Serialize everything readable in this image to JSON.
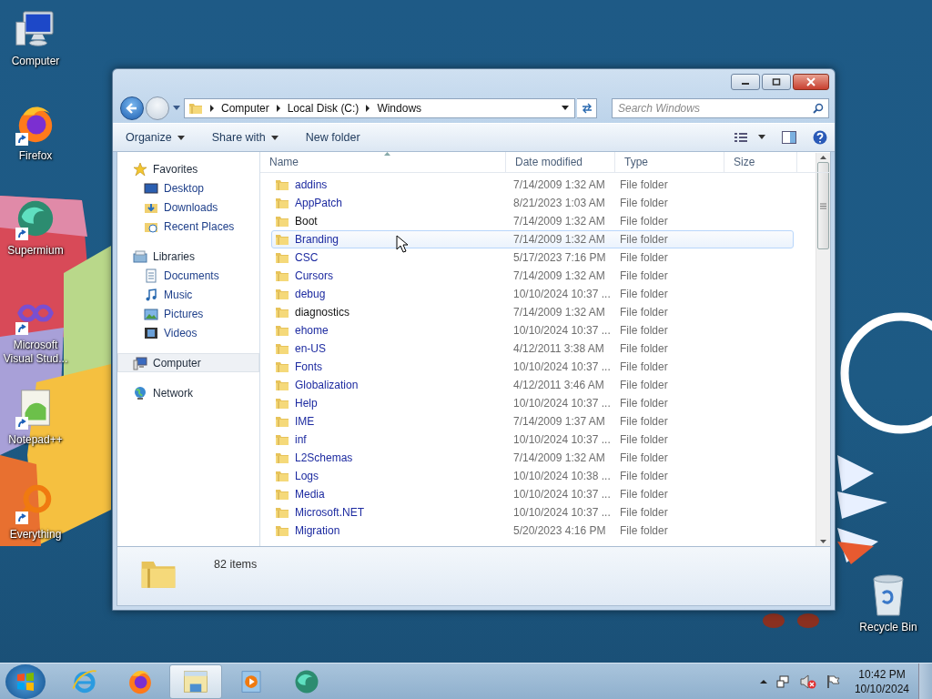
{
  "desktop_icons": [
    {
      "label": "Computer",
      "kind": "computer",
      "shortcut": false
    },
    {
      "label": "Firefox",
      "kind": "firefox",
      "shortcut": true
    },
    {
      "label": "Supermium",
      "kind": "supermium",
      "shortcut": true
    },
    {
      "label": "Microsoft Visual Stud...",
      "kind": "visualstudio",
      "shortcut": true
    },
    {
      "label": "Notepad++",
      "kind": "notepad",
      "shortcut": true
    },
    {
      "label": "Everything",
      "kind": "everything",
      "shortcut": true
    }
  ],
  "recycle_bin": {
    "label": "Recycle Bin"
  },
  "window": {
    "address": {
      "crumbs": [
        "Computer",
        "Local Disk (C:)",
        "Windows"
      ]
    },
    "search": {
      "placeholder": "Search Windows"
    },
    "toolbar": [
      {
        "label": "Organize",
        "dropdown": true
      },
      {
        "label": "Share with",
        "dropdown": true
      },
      {
        "label": "New folder",
        "dropdown": false
      }
    ],
    "nav": [
      {
        "label": "Favorites",
        "kind": "star",
        "selected": false,
        "children": [
          {
            "label": "Desktop",
            "kind": "desktop",
            "selected": false
          },
          {
            "label": "Downloads",
            "kind": "downloads",
            "selected": false
          },
          {
            "label": "Recent Places",
            "kind": "recent",
            "selected": false
          }
        ]
      },
      {
        "label": "Libraries",
        "kind": "libraries",
        "selected": false,
        "children": [
          {
            "label": "Documents",
            "kind": "documents",
            "selected": false
          },
          {
            "label": "Music",
            "kind": "music",
            "selected": false
          },
          {
            "label": "Pictures",
            "kind": "pictures",
            "selected": false
          },
          {
            "label": "Videos",
            "kind": "videos",
            "selected": false
          }
        ]
      },
      {
        "label": "Computer",
        "kind": "computer",
        "selected": true
      },
      {
        "label": "Network",
        "kind": "network",
        "selected": false
      }
    ],
    "columns": [
      "Name",
      "Date modified",
      "Type",
      "Size"
    ],
    "rows": [
      {
        "name": "addins",
        "date": "7/14/2009 1:32 AM",
        "type": "File folder",
        "compressed": true,
        "hovered": false
      },
      {
        "name": "AppPatch",
        "date": "8/21/2023 1:03 AM",
        "type": "File folder",
        "compressed": true,
        "hovered": false
      },
      {
        "name": "Boot",
        "date": "7/14/2009 1:32 AM",
        "type": "File folder",
        "compressed": false,
        "hovered": false
      },
      {
        "name": "Branding",
        "date": "7/14/2009 1:32 AM",
        "type": "File folder",
        "compressed": true,
        "hovered": true
      },
      {
        "name": "CSC",
        "date": "5/17/2023 7:16 PM",
        "type": "File folder",
        "compressed": true,
        "hovered": false
      },
      {
        "name": "Cursors",
        "date": "7/14/2009 1:32 AM",
        "type": "File folder",
        "compressed": true,
        "hovered": false
      },
      {
        "name": "debug",
        "date": "10/10/2024 10:37 ...",
        "type": "File folder",
        "compressed": true,
        "hovered": false
      },
      {
        "name": "diagnostics",
        "date": "7/14/2009 1:32 AM",
        "type": "File folder",
        "compressed": false,
        "hovered": false
      },
      {
        "name": "ehome",
        "date": "10/10/2024 10:37 ...",
        "type": "File folder",
        "compressed": true,
        "hovered": false
      },
      {
        "name": "en-US",
        "date": "4/12/2011 3:38 AM",
        "type": "File folder",
        "compressed": true,
        "hovered": false
      },
      {
        "name": "Fonts",
        "date": "10/10/2024 10:37 ...",
        "type": "File folder",
        "compressed": true,
        "hovered": false
      },
      {
        "name": "Globalization",
        "date": "4/12/2011 3:46 AM",
        "type": "File folder",
        "compressed": true,
        "hovered": false
      },
      {
        "name": "Help",
        "date": "10/10/2024 10:37 ...",
        "type": "File folder",
        "compressed": true,
        "hovered": false
      },
      {
        "name": "IME",
        "date": "7/14/2009 1:37 AM",
        "type": "File folder",
        "compressed": true,
        "hovered": false
      },
      {
        "name": "inf",
        "date": "10/10/2024 10:37 ...",
        "type": "File folder",
        "compressed": true,
        "hovered": false
      },
      {
        "name": "L2Schemas",
        "date": "7/14/2009 1:32 AM",
        "type": "File folder",
        "compressed": true,
        "hovered": false
      },
      {
        "name": "Logs",
        "date": "10/10/2024 10:38 ...",
        "type": "File folder",
        "compressed": true,
        "hovered": false
      },
      {
        "name": "Media",
        "date": "10/10/2024 10:37 ...",
        "type": "File folder",
        "compressed": true,
        "hovered": false
      },
      {
        "name": "Microsoft.NET",
        "date": "10/10/2024 10:37 ...",
        "type": "File folder",
        "compressed": true,
        "hovered": false
      },
      {
        "name": "Migration",
        "date": "5/20/2023 4:16 PM",
        "type": "File folder",
        "compressed": true,
        "hovered": false
      }
    ],
    "status": {
      "count": "82 items"
    }
  },
  "taskbar": {
    "apps": [
      {
        "kind": "ie",
        "active": false
      },
      {
        "kind": "firefox",
        "active": false
      },
      {
        "kind": "explorer",
        "active": true
      },
      {
        "kind": "mediaplayer",
        "active": false
      },
      {
        "kind": "supermium",
        "active": false
      }
    ],
    "clock": {
      "time": "10:42 PM",
      "date": "10/10/2024"
    }
  }
}
